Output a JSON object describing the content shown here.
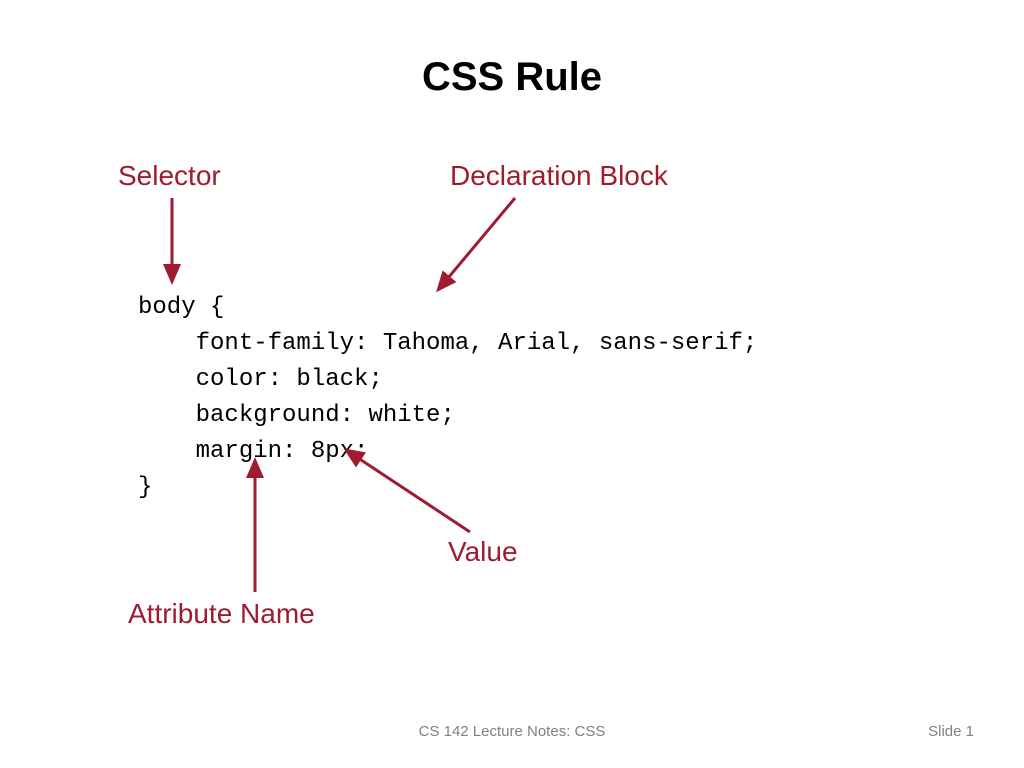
{
  "title": "CSS Rule",
  "labels": {
    "selector": "Selector",
    "declaration": "Declaration Block",
    "value": "Value",
    "attribute": "Attribute Name"
  },
  "code": "body {\n    font-family: Tahoma, Arial, sans-serif;\n    color: black;\n    background: white;\n    margin: 8px;\n}",
  "footer": {
    "center": "CS 142 Lecture Notes: CSS",
    "right": "Slide 1"
  }
}
